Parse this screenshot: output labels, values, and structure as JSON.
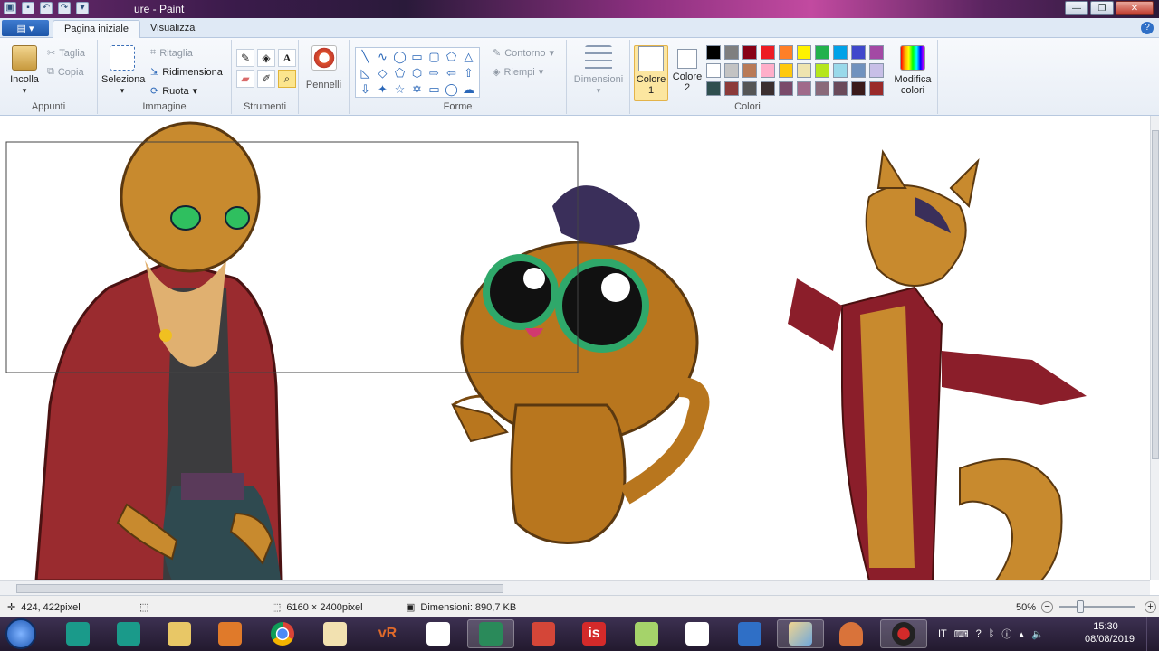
{
  "window": {
    "title": "ure - Paint"
  },
  "tabs": {
    "file": "▤ ▾",
    "home": "Pagina iniziale",
    "view": "Visualizza"
  },
  "ribbon": {
    "clipboard": {
      "paste": "Incolla",
      "cut": "Taglia",
      "copy": "Copia",
      "label": "Appunti"
    },
    "image": {
      "select": "Seleziona",
      "crop": "Ritaglia",
      "resize": "Ridimensiona",
      "rotate": "Ruota",
      "label": "Immagine"
    },
    "tools": {
      "label": "Strumenti"
    },
    "brushes": {
      "label": "Pennelli"
    },
    "shapes": {
      "outline": "Contorno",
      "fill": "Riempi",
      "label": "Forme"
    },
    "size": {
      "label": "Dimensioni"
    },
    "colors": {
      "color1": "Colore 1",
      "color2": "Colore 2",
      "edit": "Modifica colori",
      "label": "Colori",
      "palette": [
        "#000000",
        "#7f7f7f",
        "#880015",
        "#ed1c24",
        "#ff7f27",
        "#fff200",
        "#22b14c",
        "#00a2e8",
        "#3f48cc",
        "#a349a4",
        "#ffffff",
        "#c3c3c3",
        "#b97a57",
        "#ffaec9",
        "#ffc90e",
        "#efe4b0",
        "#b5e61d",
        "#99d9ea",
        "#7092be",
        "#c8bfe7",
        "#2f4f4f",
        "#8b3a3a",
        "#555555",
        "#3b2f2f",
        "#7a4a6a",
        "#a06a8a",
        "#8a6a7a",
        "#6a4a5a",
        "#3a1a1a",
        "#9a2a2a"
      ]
    }
  },
  "status": {
    "cursor": "424, 422pixel",
    "image_size": "6160 × 2400pixel",
    "file_size": "Dimensioni: 890,7 KB",
    "zoom": "50%"
  },
  "taskbar": {
    "lang": "IT",
    "time": "15:30",
    "date": "08/08/2019"
  }
}
